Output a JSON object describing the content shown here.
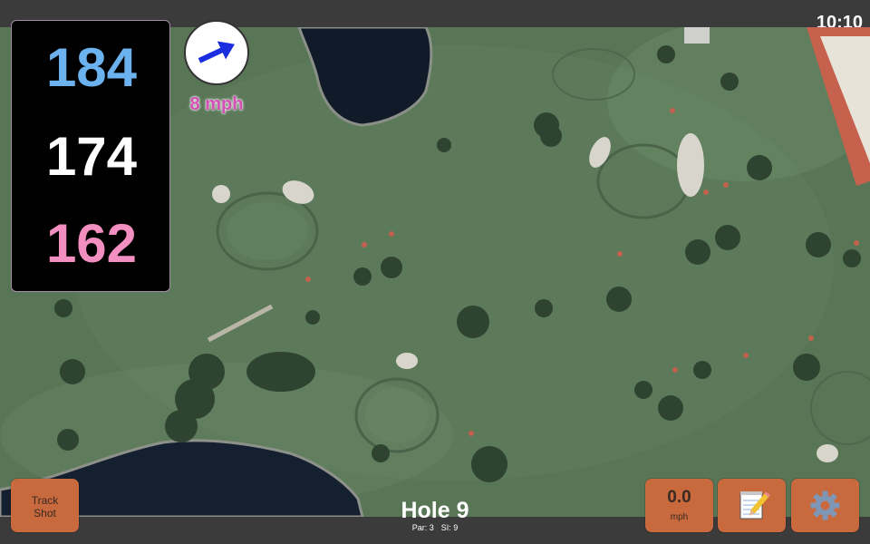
{
  "status_bar": {
    "time": "10:10"
  },
  "distances": {
    "back": {
      "value": "184",
      "color": "#6bb2ee"
    },
    "center": {
      "value": "174",
      "color": "#ffffff"
    },
    "front": {
      "value": "162",
      "color": "#f28fc0"
    }
  },
  "wind": {
    "speed_label": "8 mph",
    "speed_color": "#d34fb4",
    "arrow_icon": "arrow-right-icon",
    "arrow_color": "#1a2ee0"
  },
  "hole": {
    "title": "Hole 9",
    "par_label": "Par: 3",
    "si_label": "SI: 9"
  },
  "buttons": {
    "track_line1": "Track",
    "track_line2": "Shot",
    "speed_value": "0.0",
    "speed_unit": "mph",
    "notes_icon": "notepad-icon",
    "settings_icon": "gear-icon"
  },
  "map": {
    "type": "satellite aerial view",
    "colors": {
      "fairway": "#5c7a5b",
      "water": "#101a2a",
      "sand": "#d9d6cc",
      "path": "#c45d4a"
    }
  }
}
